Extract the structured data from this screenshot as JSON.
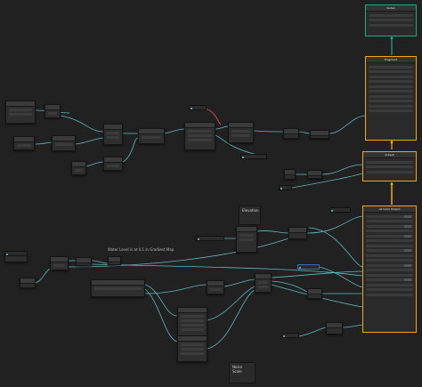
{
  "graph": {
    "background": "#212121",
    "wire_color": "#5fb8bf",
    "wire_highlight": "#e24a62",
    "flow_color": "#f2a80f",
    "output_color": "#1fa88a"
  },
  "notes": {
    "water_level": "Water Level is at 0.1 in Gradient Map",
    "elevation": "Elevation",
    "noise_scale": "Noise Scale"
  },
  "master_stack": {
    "output_title": "Vertex",
    "fragment_title": "Fragment",
    "top_title": "Output",
    "lit_title": "Lit Color Output"
  }
}
